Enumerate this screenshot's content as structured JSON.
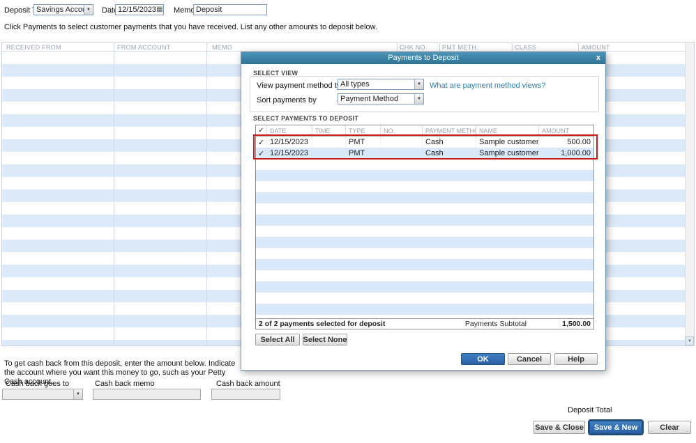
{
  "colors": {
    "dialog_titlebar": "#3c89ad",
    "row_stripe": "#dbe9f8",
    "accent_blue": "#2e6db6",
    "link_blue": "#2e7cab",
    "annotation_red": "#cc1a1a"
  },
  "icons": {
    "dropdown": "▼",
    "calendar": "▦",
    "close": "x",
    "check": "✓",
    "scroll_down": "▼"
  },
  "topbar": {
    "deposit_to_label": "Deposit To",
    "deposit_to_value": "Savings Account",
    "date_label": "Date",
    "date_value": "12/15/2023",
    "memo_label": "Memo",
    "memo_value": "Deposit"
  },
  "instruction": "Click Payments to select customer payments that you have received. List any other amounts to deposit below.",
  "deposit_table": {
    "columns": [
      "RECEIVED FROM",
      "FROM ACCOUNT",
      "MEMO",
      "CHK NO.",
      "PMT METH.",
      "CLASS",
      "AMOUNT"
    ]
  },
  "cash_back": {
    "instruction": "To get cash back from this deposit, enter the amount below.  Indicate the account where you want this money to go, such as your Petty Cash account.",
    "goes_to_label": "Cash back goes to",
    "memo_label": "Cash back memo",
    "amount_label": "Cash back amount"
  },
  "totals": {
    "deposit_total_label": "Deposit Total"
  },
  "actions": {
    "save_close": "Save & Close",
    "save_new": "Save & New",
    "clear": "Clear"
  },
  "dialog": {
    "title": "Payments to Deposit",
    "select_view": {
      "section_label": "SELECT VIEW",
      "view_label": "View payment method type",
      "view_value": "All types",
      "help_link": "What are payment method views?",
      "sort_label": "Sort payments by",
      "sort_value": "Payment Method"
    },
    "select_payments_label": "SELECT PAYMENTS TO DEPOSIT",
    "table": {
      "columns": [
        "DATE",
        "TIME",
        "TYPE",
        "NO.",
        "PAYMENT METHOD",
        "NAME",
        "AMOUNT"
      ],
      "rows": [
        {
          "date": "12/15/2023",
          "time": "",
          "type": "PMT",
          "no": "",
          "payment_method": "Cash",
          "name": "Sample customer",
          "amount": "500.00"
        },
        {
          "date": "12/15/2023",
          "time": "",
          "type": "PMT",
          "no": "",
          "payment_method": "Cash",
          "name": "Sample customer",
          "amount": "1,000.00"
        }
      ]
    },
    "summary": {
      "selected_text": "2 of 2 payments selected for deposit",
      "subtotal_label": "Payments Subtotal",
      "subtotal_value": "1,500.00"
    },
    "buttons": {
      "select_all": "Select All",
      "select_none": "Select None",
      "ok": "OK",
      "cancel": "Cancel",
      "help": "Help"
    }
  }
}
